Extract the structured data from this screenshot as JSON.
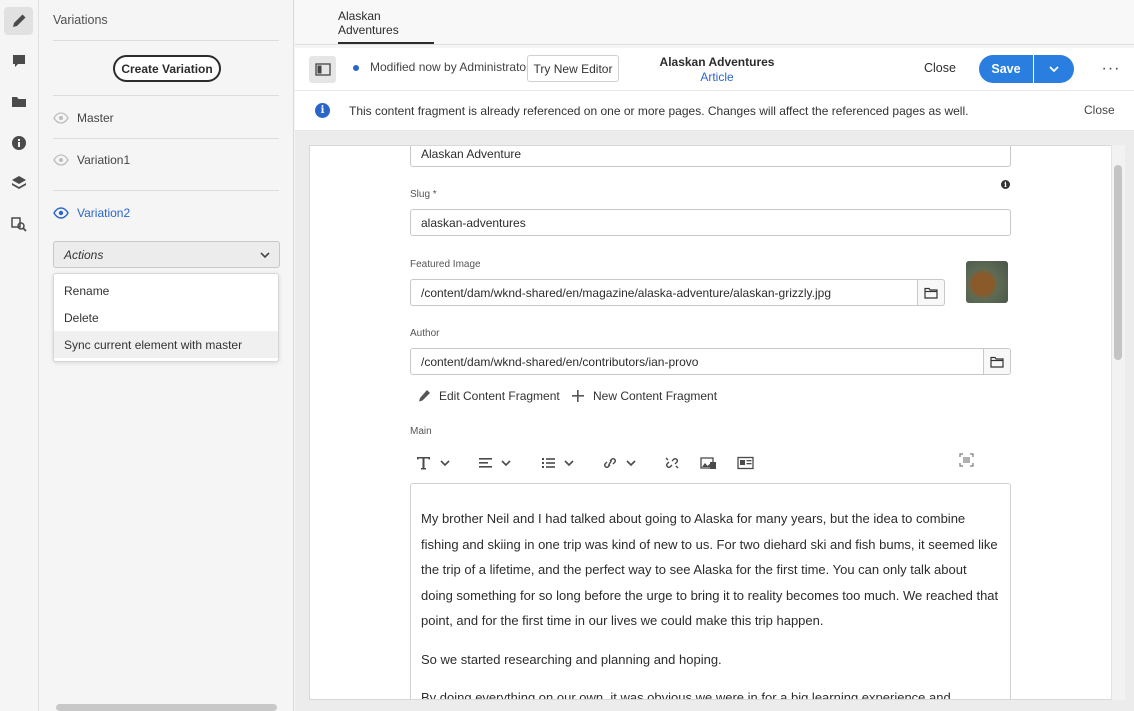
{
  "rail": {
    "items": [
      {
        "icon": "pencil-icon",
        "active": true
      },
      {
        "icon": "comment-icon",
        "active": false
      },
      {
        "icon": "folder-icon",
        "active": false
      },
      {
        "icon": "info-icon",
        "active": false
      },
      {
        "icon": "layers-icon",
        "active": false
      },
      {
        "icon": "search-asset-icon",
        "active": false
      }
    ]
  },
  "variations": {
    "title": "Variations",
    "create_label": "Create Variation",
    "items": [
      {
        "label": "Master",
        "selected": false
      },
      {
        "label": "Variation1",
        "selected": false
      },
      {
        "label": "Variation2",
        "selected": true
      }
    ],
    "actions_label": "Actions",
    "actions_menu": [
      "Rename",
      "Delete",
      "Sync current element with master"
    ]
  },
  "tabs": [
    {
      "label": "Alaskan Adventures"
    }
  ],
  "toolbar": {
    "status": "Modified now by Administrator",
    "try_label": "Try New Editor",
    "title": "Alaskan Adventures",
    "model": "Article",
    "close_label": "Close",
    "save_label": "Save",
    "more_label": "···"
  },
  "banner": {
    "text": "This content fragment is already referenced on one or more pages. Changes will affect the referenced pages as well.",
    "close_label": "Close"
  },
  "form": {
    "title_value": "Alaskan Adventure",
    "slug_label": "Slug *",
    "slug_value": "alaskan-adventures",
    "featured_label": "Featured Image",
    "featured_value": "/content/dam/wknd-shared/en/magazine/alaska-adventure/alaskan-grizzly.jpg",
    "author_label": "Author",
    "author_value": "/content/dam/wknd-shared/en/contributors/ian-provo",
    "edit_cf_label": "Edit Content Fragment",
    "new_cf_label": "New Content Fragment",
    "main_label": "Main",
    "main_paragraphs": [
      "My brother Neil and I had talked about going to Alaska for many years, but the idea to combine fishing and skiing in one trip was kind of new to us. For two diehard ski and fish bums, it seemed like the trip of a lifetime, and the perfect way to see Alaska for the first time. You can only talk about doing something for so long before the urge to bring it to reality becomes too much. We reached that point, and for the first time in our lives we could make this trip happen.",
      "So we started researching and planning and hoping.",
      "By doing everything on our own, it was obvious we were in for a big learning experience and perhaps more"
    ]
  },
  "colors": {
    "accent": "#2a66c9",
    "save": "#2a7ee0"
  }
}
